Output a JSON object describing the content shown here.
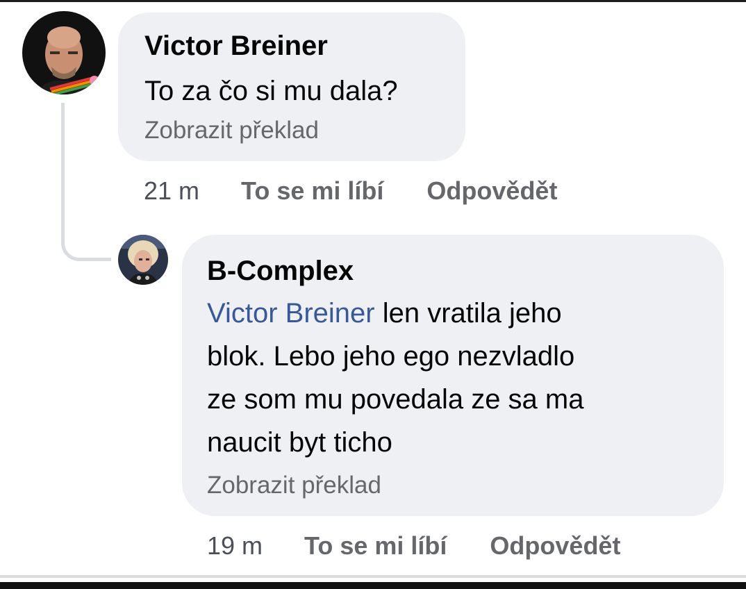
{
  "comments": [
    {
      "author": "Victor Breiner",
      "text": "To za čo si mu dala?",
      "translate_label": "Zobrazit překlad",
      "time": "21 m",
      "like_label": "To se mi líbí",
      "reply_label": "Odpovědět"
    },
    {
      "author": "B-Complex",
      "mention": "Victor Breiner",
      "text_lines": [
        " len vratila jeho",
        "blok. Lebo jeho ego nezvladlo",
        "ze som mu povedala ze sa ma",
        "naucit byt ticho"
      ],
      "translate_label": "Zobrazit překlad",
      "time": "19 m",
      "like_label": "To se mi líbí",
      "reply_label": "Odpovědět"
    }
  ],
  "colors": {
    "bubble": "#eef0f3",
    "mention": "#385898",
    "secondary_text": "#65676b"
  }
}
